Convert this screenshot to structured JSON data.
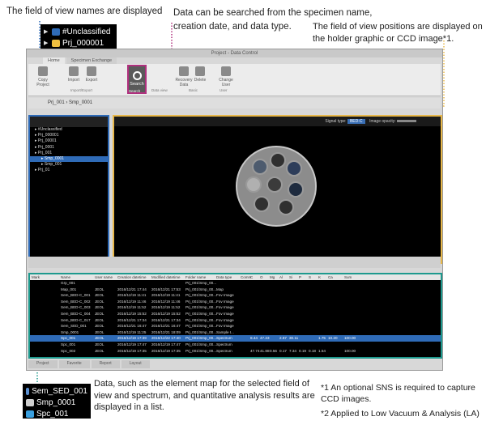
{
  "callouts": {
    "fov_names": "The field of view names are displayed",
    "search_line1": "Data can be searched from the specimen name,",
    "search_line2": "creation date, and data type.",
    "fov_positions": "The field of view positions are displayed on the holder graphic or CCD image*1.",
    "data_desc": "Data, such as the element map for the selected field of view and spectrum, and quantitative analysis results are displayed in a list.",
    "note1": "*1 An optional SNS is required to capture CCD images.",
    "note2": "*2 Applied to Low Vacuum & Analysis (LA)"
  },
  "zoom_tree": [
    {
      "label": "#Unclassified",
      "icon": "globe-icon"
    },
    {
      "label": "Prj_000001",
      "icon": "folder-icon"
    },
    {
      "label": "Prj_00001",
      "icon": "folder-icon"
    }
  ],
  "zoom_list": [
    {
      "label": "Sem_SED_001",
      "icon": "image-icon"
    },
    {
      "label": "Smp_0001",
      "icon": "specimen-icon"
    },
    {
      "label": "Spc_001",
      "icon": "spectrum-icon"
    }
  ],
  "app": {
    "title": "Project - Data Control",
    "tabs": [
      "Home",
      "Specimen Exchange"
    ],
    "ribbon": {
      "copy": "Copy Project",
      "import": "Import",
      "export": "Export",
      "search": "Search",
      "recovery": "Recovery Data",
      "delete": "Delete",
      "change_user": "Change User"
    },
    "groups": {
      "import_export": "Import/Export",
      "search": "Search",
      "data_view": "Data view",
      "basic": "Basic",
      "user": "User"
    },
    "breadcrumb": [
      "Prj_001",
      "Smp_0001"
    ],
    "signal_type_label": "Signal type:",
    "signal_type_value": "BED-C",
    "image_opacity_label": "Image opacity:",
    "tree_items": [
      "#Unclassified",
      "Prj_000001",
      "Prj_00001",
      "Prj_0001",
      "Prj_001",
      "Smp_0001",
      "Smp_001",
      "Prj_01"
    ],
    "list_columns": [
      "Mark",
      "Name",
      "User name",
      "Creation datetime",
      "Modified datetime",
      "Folder name",
      "Data type",
      "Comm",
      "C",
      "O",
      "Mg",
      "Al",
      "Si",
      "P",
      "S",
      "K",
      "Ca",
      "Sum"
    ],
    "list_rows": [
      {
        "name": "Grp_001",
        "user": "",
        "created": "",
        "modified": "",
        "folder": "Prj_001\\Smp_00...",
        "type": "",
        "vals": [
          "",
          "",
          "",
          "",
          "",
          "",
          "",
          "",
          "",
          ""
        ]
      },
      {
        "name": "Map_001",
        "user": "JEOL",
        "created": "2016/12/21 17:44",
        "modified": "2016/12/21 17:53",
        "folder": "Prj_001\\Smp_00...",
        "type": "Map",
        "vals": [
          "",
          "",
          "",
          "",
          "",
          "",
          "",
          "",
          "",
          ""
        ]
      },
      {
        "name": "Sem_BED-C_001",
        "user": "JEOL",
        "created": "2016/12/19 11:41",
        "modified": "2016/12/19 11:41",
        "folder": "Prj_001\\Smp_00...",
        "type": "Fov Image",
        "vals": [
          "",
          "",
          "",
          "",
          "",
          "",
          "",
          "",
          "",
          ""
        ]
      },
      {
        "name": "Sem_BED-C_002",
        "user": "JEOL",
        "created": "2016/12/19 11:46",
        "modified": "2016/12/19 11:46",
        "folder": "Prj_001\\Smp_00...",
        "type": "Fov Image",
        "vals": [
          "",
          "",
          "",
          "",
          "",
          "",
          "",
          "",
          "",
          ""
        ]
      },
      {
        "name": "Sem_BED-C_003",
        "user": "JEOL",
        "created": "2016/12/19 11:52",
        "modified": "2016/12/19 11:52",
        "folder": "Prj_001\\Smp_00...",
        "type": "Fov Image",
        "vals": [
          "",
          "",
          "",
          "",
          "",
          "",
          "",
          "",
          "",
          ""
        ]
      },
      {
        "name": "Sem_BED-C_004",
        "user": "JEOL",
        "created": "2016/12/19 15:52",
        "modified": "2016/12/19 15:52",
        "folder": "Prj_001\\Smp_00...",
        "type": "Fov Image",
        "vals": [
          "",
          "",
          "",
          "",
          "",
          "",
          "",
          "",
          "",
          ""
        ]
      },
      {
        "name": "Sem_BED-C_017",
        "user": "JEOL",
        "created": "2016/12/21 17:34",
        "modified": "2016/12/21 17:34",
        "folder": "Prj_001\\Smp_00...",
        "type": "Fov Image",
        "vals": [
          "",
          "",
          "",
          "",
          "",
          "",
          "",
          "",
          "",
          ""
        ]
      },
      {
        "name": "Sem_SED_001",
        "user": "JEOL",
        "created": "2016/12/21 16:47",
        "modified": "2016/12/21 16:47",
        "folder": "Prj_001\\Smp_00...",
        "type": "Fov Image",
        "vals": [
          "",
          "",
          "",
          "",
          "",
          "",
          "",
          "",
          "",
          ""
        ]
      },
      {
        "name": "Smp_0001",
        "user": "JEOL",
        "created": "2016/12/19 11:25",
        "modified": "2016/12/21 18:09",
        "folder": "Prj_001\\Smp_00...",
        "type": "Sample I...",
        "vals": [
          "",
          "",
          "",
          "",
          "",
          "",
          "",
          "",
          "",
          ""
        ]
      },
      {
        "name": "Spc_001",
        "user": "JEOL",
        "created": "2016/12/19 17:39",
        "modified": "2016/12/22 17:40",
        "folder": "Prj_001\\Smp_00...",
        "type": "Spectrum",
        "vals": [
          "8.44",
          "47.23",
          "",
          "2.67",
          "30.11",
          "",
          "",
          "1.75",
          "10.20",
          "100.00"
        ]
      },
      {
        "name": "Spc_001",
        "user": "JEOL",
        "created": "2016/12/19 17:47",
        "modified": "2016/12/19 17:47",
        "folder": "Prj_001\\Smp_00...",
        "type": "Spectrum",
        "vals": [
          "",
          "",
          "",
          "",
          "",
          "",
          "",
          "",
          "",
          ""
        ]
      },
      {
        "name": "Spc_002",
        "user": "JEOL",
        "created": "2016/12/19 17:35",
        "modified": "2016/12/19 17:35",
        "folder": "Prj_001\\Smp_00...",
        "type": "Spectrum",
        "vals": [
          "47.74",
          "41.88",
          "0.56",
          "0.17",
          "7.34",
          "0.19",
          "0.18",
          "1.54",
          "",
          "100.00"
        ]
      }
    ],
    "bottom_tabs": [
      "Project",
      "Favorite",
      "Report",
      "Layout"
    ]
  },
  "colors": {
    "tree_border": "#2f6bb7",
    "view_border": "#e8b84a",
    "list_border": "#1e9a8e",
    "search_border": "#b0307e"
  }
}
